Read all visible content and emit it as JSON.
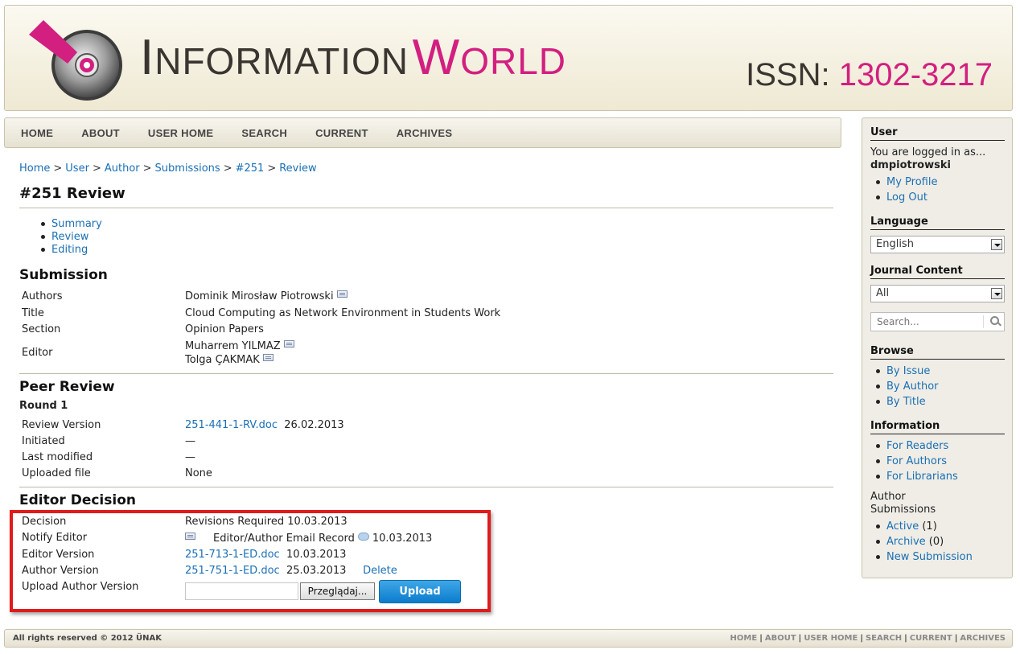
{
  "header": {
    "title_word1_first": "I",
    "title_word1_rest": "NFORMATION",
    "title_word2_first": "W",
    "title_word2_rest": "ORLD",
    "issn_label": "ISSN: ",
    "issn_number": "1302-3217",
    "colors": {
      "accent": "#d21f80",
      "dark": "#3a3530"
    }
  },
  "nav": [
    "HOME",
    "ABOUT",
    "USER HOME",
    "SEARCH",
    "CURRENT",
    "ARCHIVES"
  ],
  "breadcrumb": [
    "Home",
    "User",
    "Author",
    "Submissions",
    "#251",
    "Review"
  ],
  "breadcrumb_sep": ">",
  "page_title": "#251 Review",
  "subnav": [
    "Summary",
    "Review",
    "Editing"
  ],
  "submission": {
    "heading": "Submission",
    "authors_label": "Authors",
    "authors_value": "Dominik Mirosław Piotrowski",
    "title_label": "Title",
    "title_value": "Cloud Computing as Network Environment in Students Work",
    "section_label": "Section",
    "section_value": "Opinion Papers",
    "editor_label": "Editor",
    "editor_1": "Muharrem YILMAZ",
    "editor_2": "Tolga ÇAKMAK"
  },
  "peer_review": {
    "heading": "Peer Review",
    "round": "Round 1",
    "review_version_label": "Review Version",
    "review_version_file": "251-441-1-RV.doc",
    "review_version_date": "26.02.2013",
    "initiated_label": "Initiated",
    "initiated_value": "—",
    "last_modified_label": "Last modified",
    "last_modified_value": "—",
    "uploaded_file_label": "Uploaded file",
    "uploaded_file_value": "None"
  },
  "editor_decision": {
    "heading": "Editor Decision",
    "decision_label": "Decision",
    "decision_value": "Revisions Required 10.03.2013",
    "notify_label": "Notify Editor",
    "notify_record": "Editor/Author Email Record",
    "notify_date": "10.03.2013",
    "editor_version_label": "Editor Version",
    "editor_version_file": "251-713-1-ED.doc",
    "editor_version_date": "10.03.2013",
    "author_version_label": "Author Version",
    "author_version_file": "251-751-1-ED.doc",
    "author_version_date": "25.03.2013",
    "delete_label": "Delete",
    "upload_author_label": "Upload Author Version",
    "browse_label": "Przeglądaj...",
    "upload_label": "Upload"
  },
  "sidebar": {
    "user_title": "User",
    "logged_in_text": "You are logged in as...",
    "username": "dmpiotrowski",
    "user_links": [
      "My Profile",
      "Log Out"
    ],
    "language_title": "Language",
    "language_selected": "English",
    "journal_content_title": "Journal Content",
    "journal_content_selected": "All",
    "search_placeholder": "Search...",
    "browse_title": "Browse",
    "browse_links": [
      "By Issue",
      "By Author",
      "By Title"
    ],
    "information_title": "Information",
    "information_links": [
      "For Readers",
      "For Authors",
      "For Librarians"
    ],
    "author_sub_title_1": "Author",
    "author_sub_title_2": "Submissions",
    "active_label": "Active",
    "active_count": "(1)",
    "archive_label": "Archive",
    "archive_count": "(0)",
    "new_submission_label": "New Submission"
  },
  "footer": {
    "copyright": "All rights reserved © 2012 ÜNAK",
    "links": [
      "HOME",
      "ABOUT",
      "USER HOME",
      "SEARCH",
      "CURRENT",
      "ARCHIVES"
    ],
    "sep": "|"
  }
}
